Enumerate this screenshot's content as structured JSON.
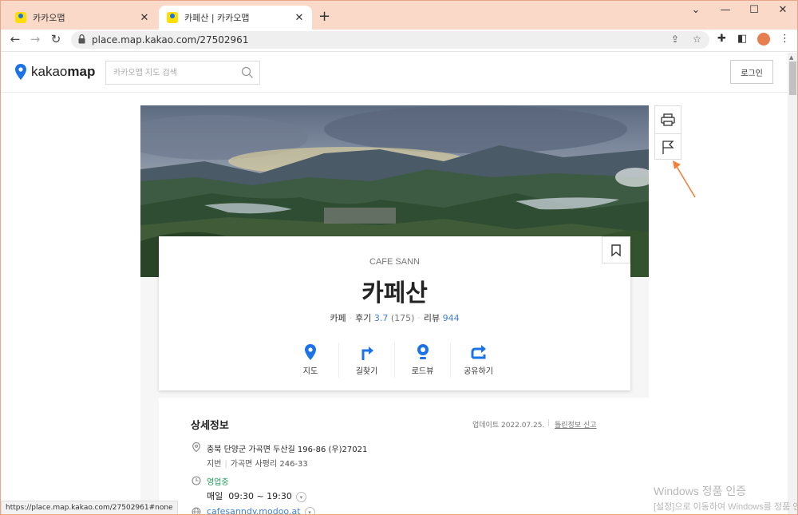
{
  "browser": {
    "tabs": [
      {
        "title": "카카오맵"
      },
      {
        "title": "카페산 | 카카오맵"
      }
    ],
    "new_tab": "+",
    "url": "place.map.kakao.com/27502961",
    "status_url": "https://place.map.kakao.com/27502961#none"
  },
  "header": {
    "logo_prefix": "kakao",
    "logo_suffix": "map",
    "search_placeholder": "카카오맵 지도 검색",
    "login_label": "로그인"
  },
  "place": {
    "name_en": "CAFE SANN",
    "name_ko": "카페산",
    "category": "카페",
    "review_label": "후기",
    "rating": "3.7",
    "rating_count": "(175)",
    "blog_label": "리뷰",
    "blog_count": "944"
  },
  "actions": [
    {
      "label": "지도"
    },
    {
      "label": "길찾기"
    },
    {
      "label": "로드뷰"
    },
    {
      "label": "공유하기"
    }
  ],
  "details": {
    "heading": "상세정보",
    "updated": "업데이트 2022.07.25.",
    "report": "틀린정보 신고",
    "address": "충북 단양군 가곡면 두산길 196-86 (우)27021",
    "jibun_label": "지번",
    "jibun": "가곡면 사평리 246-33",
    "open_status": "영업중",
    "hours_day": "매일",
    "hours": "09:30 ~ 19:30",
    "website": "cafesanndy.modoo.at"
  },
  "watermark": {
    "line1": "Windows 정품 인증",
    "line2": "[설정]으로 이동하여 Windows를 정품 인증합니다."
  },
  "colors": {
    "tabstrip": "#fbd9c8",
    "kakao_blue": "#1a73e8",
    "link_blue": "#4080d8",
    "open_green": "#1f9a57",
    "arrow_orange": "#f0803c"
  }
}
